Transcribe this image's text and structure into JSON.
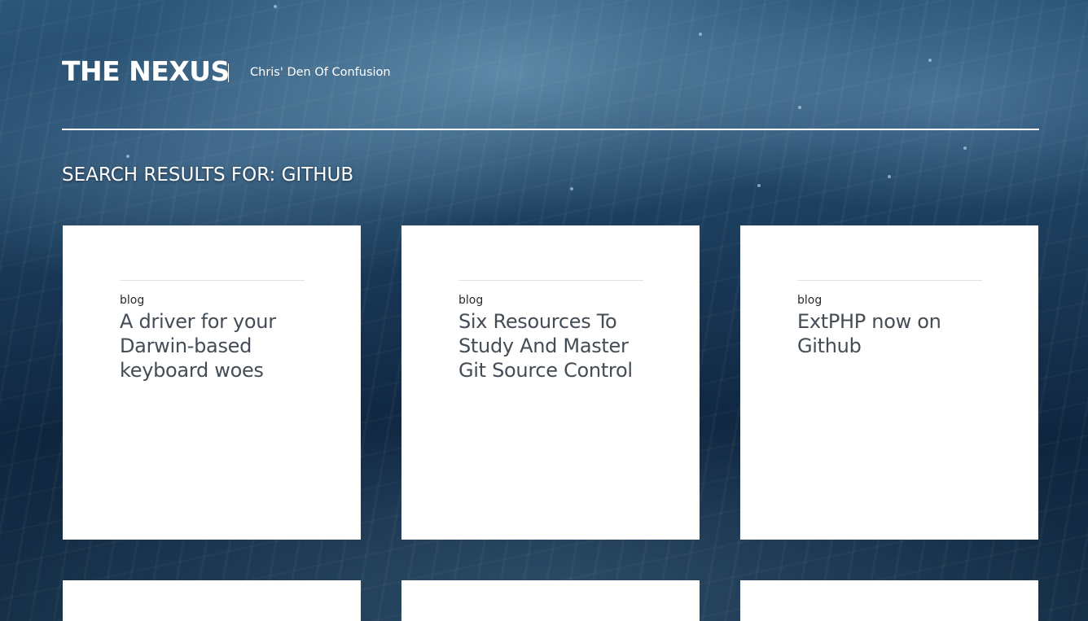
{
  "site": {
    "title": "THE NEXUS",
    "tagline": "Chris' Den Of Confusion"
  },
  "search": {
    "heading": "SEARCH RESULTS FOR: GITHUB"
  },
  "results": [
    {
      "category": "blog",
      "title": "A driver for your Darwin-based keyboard woes"
    },
    {
      "category": "blog",
      "title": "Six Resources To Study And Master Git Source Control"
    },
    {
      "category": "blog",
      "title": "ExtPHP now on Github"
    }
  ],
  "colors": {
    "background": "#183755",
    "card": "#ffffff",
    "post_title": "#444c55"
  }
}
